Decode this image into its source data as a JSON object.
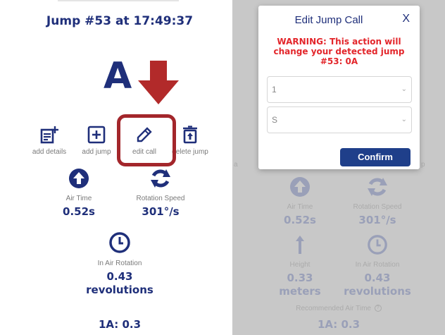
{
  "left": {
    "title": "Jump #53 at 17:49:37",
    "big_letter": "A",
    "actions": [
      {
        "label": "add details",
        "icon": "add-details-icon"
      },
      {
        "label": "add jump",
        "icon": "add-jump-icon"
      },
      {
        "label": "edit call",
        "icon": "edit-pencil-icon"
      },
      {
        "label": "delete jump",
        "icon": "trash-icon"
      }
    ],
    "stats": {
      "air_time": {
        "label": "Air Time",
        "value": "0.52s",
        "icon": "up-arrow-circle-icon"
      },
      "rotation_speed": {
        "label": "Rotation Speed",
        "value": "301°/s",
        "icon": "rotate-icon"
      },
      "in_air_rotation": {
        "label": "In Air Rotation",
        "value_line1": "0.43",
        "value_line2": "revolutions",
        "icon": "clock-icon"
      }
    },
    "footer": "1A: 0.3",
    "colors": {
      "primary": "#1f2f7a",
      "highlight": "#a3262b",
      "arrow": "#b22a2a"
    }
  },
  "right": {
    "modal": {
      "title": "Edit Jump Call",
      "close_label": "X",
      "warning": "WARNING: This action will change your detected jump #53: 0A",
      "select1_value": "1",
      "select2_value": "S",
      "confirm_label": "Confirm"
    },
    "stats": {
      "air_time": {
        "label": "Air Time",
        "value": "0.52s"
      },
      "rotation_speed": {
        "label": "Rotation Speed",
        "value": "301°/s"
      },
      "height": {
        "label": "Height",
        "value_line1": "0.33",
        "value_line2": "meters"
      },
      "in_air_rotation": {
        "label": "In Air Rotation",
        "value_line1": "0.43",
        "value_line2": "revolutions"
      }
    },
    "recommended": "Recommended Air Time",
    "footer": "1A: 0.3",
    "colors": {
      "overlay": "#c8c8c8",
      "confirm": "#1f3f8a",
      "warning": "#e3262b"
    }
  }
}
